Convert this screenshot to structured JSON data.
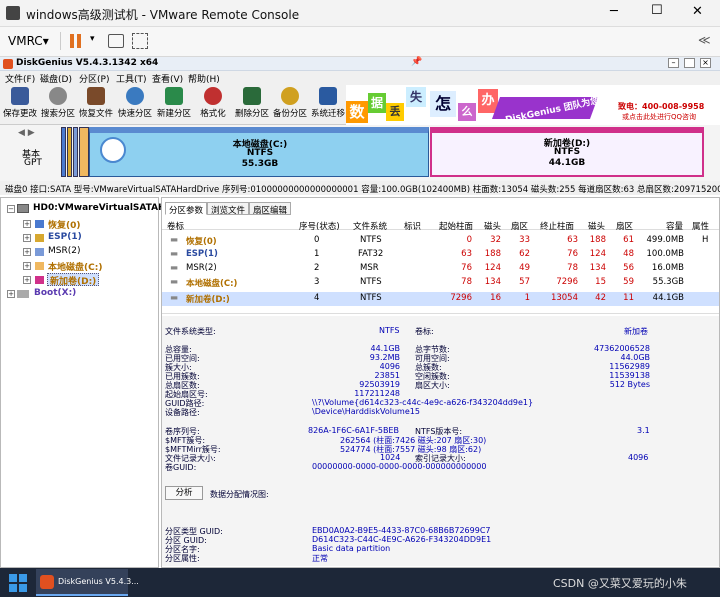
{
  "window": {
    "title": "windows高级测试机 - VMware Remote Console",
    "minimize": "─",
    "maximize": "☐",
    "close": "✕"
  },
  "vm_toolbar": {
    "vmrc_label": "VMRC",
    "dropdown": "▾",
    "collapse": "≪"
  },
  "app": {
    "title": "DiskGenius V5.4.3.1342 x64"
  },
  "menu": [
    "文件(F)",
    "磁盘(D)",
    "分区(P)",
    "工具(T)",
    "查看(V)",
    "帮助(H)"
  ],
  "toolbar": [
    "保存更改",
    "搜索分区",
    "恢复文件",
    "快速分区",
    "新建分区",
    "格式化",
    "删除分区",
    "备份分区",
    "系统迁移"
  ],
  "banner": {
    "chars": [
      "数",
      "据",
      "丢",
      "失",
      "怎",
      "么",
      "办"
    ],
    "slogan": "DiskGenius 团队为您服务",
    "phone": "致电：400-008-9958",
    "qq": "或点击此处进行QQ咨询"
  },
  "disk_map": {
    "nav_arrows": "◀ ▶",
    "label1": "基本",
    "label2": "GPT",
    "partitions": [
      {
        "name": "本地磁盘(C:)",
        "fs": "NTFS",
        "size": "55.3GB"
      },
      {
        "name": "新加卷(D:)",
        "fs": "NTFS",
        "size": "44.1GB"
      }
    ]
  },
  "disk_info": "磁盘0 接口:SATA  型号:VMwareVirtualSATAHardDrive  序列号:01000000000000000001  容量:100.0GB(102400MB)  柱面数:13054  磁头数:255  每道扇区数:63  总扇区数:209715200",
  "tree": {
    "root": "HD0:VMwareVirtualSATAH",
    "items": [
      "恢复(0)",
      "ESP(1)",
      "MSR(2)",
      "本地磁盘(C:)",
      "新加卷(D:)"
    ],
    "boot": "Boot(X:)"
  },
  "tabs": [
    "分区参数",
    "浏览文件",
    "扇区编辑"
  ],
  "table": {
    "headers": [
      "卷标",
      "序号(状态)",
      "文件系统",
      "标识",
      "起始柱面",
      "磁头",
      "扇区",
      "终止柱面",
      "磁头",
      "扇区",
      "容量",
      "属性"
    ],
    "rows": [
      [
        "恢复(0)",
        "0",
        "NTFS",
        "",
        "0",
        "32",
        "33",
        "63",
        "188",
        "61",
        "499.0MB",
        "H"
      ],
      [
        "ESP(1)",
        "1",
        "FAT32",
        "",
        "63",
        "188",
        "62",
        "76",
        "124",
        "48",
        "100.0MB",
        ""
      ],
      [
        "MSR(2)",
        "2",
        "MSR",
        "",
        "76",
        "124",
        "49",
        "78",
        "134",
        "56",
        "16.0MB",
        ""
      ],
      [
        "本地磁盘(C:)",
        "3",
        "NTFS",
        "",
        "78",
        "134",
        "57",
        "7296",
        "15",
        "59",
        "55.3GB",
        ""
      ],
      [
        "新加卷(D:)",
        "4",
        "NTFS",
        "",
        "7296",
        "16",
        "1",
        "13054",
        "42",
        "11",
        "44.1GB",
        ""
      ]
    ]
  },
  "details": {
    "fs_type_label": "文件系统类型:",
    "fs_type": "NTFS",
    "vol_label_label": "卷标:",
    "vol_label": "新加卷",
    "left": [
      [
        "总容量:",
        "44.1GB"
      ],
      [
        "已用空间:",
        "93.2MB"
      ],
      [
        "簇大小:",
        "4096"
      ],
      [
        "已用簇数:",
        "23851"
      ],
      [
        "总扇区数:",
        "92503919"
      ],
      [
        "起始扇区号:",
        "117211248"
      ]
    ],
    "right": [
      [
        "总字节数:",
        "47362006528"
      ],
      [
        "可用空间:",
        "44.0GB"
      ],
      [
        "总簇数:",
        "11562989"
      ],
      [
        "空闲簇数:",
        "11539138"
      ],
      [
        "扇区大小:",
        "512 Bytes"
      ]
    ],
    "guid_path_label": "GUID路径:",
    "guid_path": "\\\\?\\Volume{d614c323-c44c-4e9c-a626-f343204dd9e1}",
    "device_path_label": "设备路径:",
    "device_path": "\\Device\\HarddiskVolume15",
    "serial_label": "卷序列号:",
    "serial": "826A-1F6C-6A1F-5BEB",
    "ntfs_ver_label": "NTFS版本号:",
    "ntfs_ver": "3.1",
    "mft_label": "$MFT簇号:",
    "mft": "262564 (柱面:7426 磁头:207 扇区:30)",
    "mftmirr_label": "$MFTMirr簇号:",
    "mftmirr": "524774 (柱面:7557 磁头:98 扇区:62)",
    "rec_size_label": "文件记录大小:",
    "rec_size": "1024",
    "idx_size_label": "索引记录大小:",
    "idx_size": "4096",
    "vol_guid_label": "卷GUID:",
    "vol_guid": "00000000-0000-0000-0000-000000000000",
    "analyze_btn": "分析",
    "alloc_label": "数据分配情况图:",
    "ptype_guid_label": "分区类型 GUID:",
    "ptype_guid": "EBD0A0A2-B9E5-4433-87C0-68B6B72699C7",
    "part_guid_label": "分区 GUID:",
    "part_guid": "D614C323-C44C-4E9C-A626-F343204DD9E1",
    "part_name_label": "分区名字:",
    "part_name": "Basic data partition",
    "part_attr_label": "分区属性:",
    "part_attr": "正常"
  },
  "taskbar": {
    "app": "DiskGenius V5.4.3...",
    "watermark": "CSDN @又菜又爱玩的小朱"
  }
}
